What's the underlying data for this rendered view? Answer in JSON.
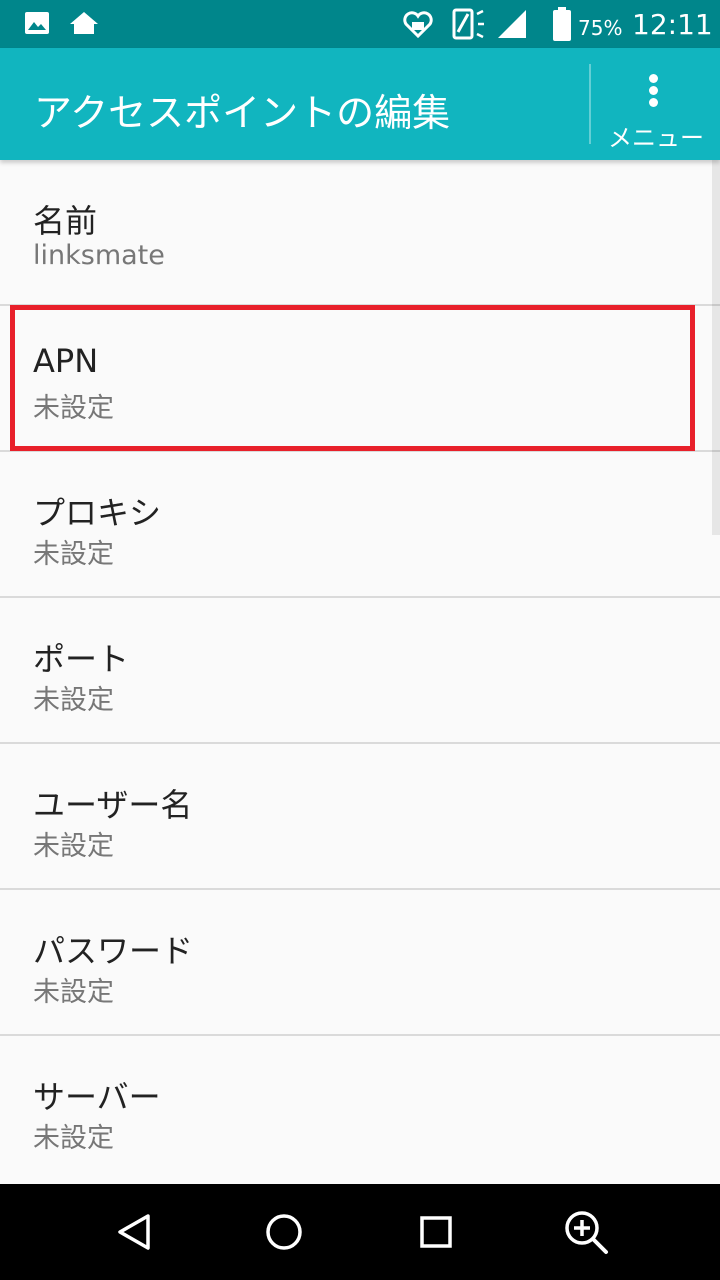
{
  "status_bar": {
    "battery_percent": "75%",
    "time": "12:11",
    "icons": [
      "image-icon",
      "home-icon",
      "heart-notification-icon",
      "vibrate-icon",
      "signal-icon",
      "battery-icon"
    ]
  },
  "app_bar": {
    "title": "アクセスポイントの編集",
    "menu_label": "メニュー"
  },
  "items": [
    {
      "title": "名前",
      "summary": "linksmate"
    },
    {
      "title": "APN",
      "summary": "未設定"
    },
    {
      "title": "プロキシ",
      "summary": "未設定"
    },
    {
      "title": "ポート",
      "summary": "未設定"
    },
    {
      "title": "ユーザー名",
      "summary": "未設定"
    },
    {
      "title": "パスワード",
      "summary": "未設定"
    },
    {
      "title": "サーバー",
      "summary": "未設定"
    }
  ],
  "highlight_color": "#e8202a",
  "colors": {
    "status_bar": "#00868b",
    "app_bar": "#11b5bf"
  },
  "nav_bar": [
    "back-icon",
    "home-circle-icon",
    "recents-icon",
    "zoom-in-icon"
  ]
}
